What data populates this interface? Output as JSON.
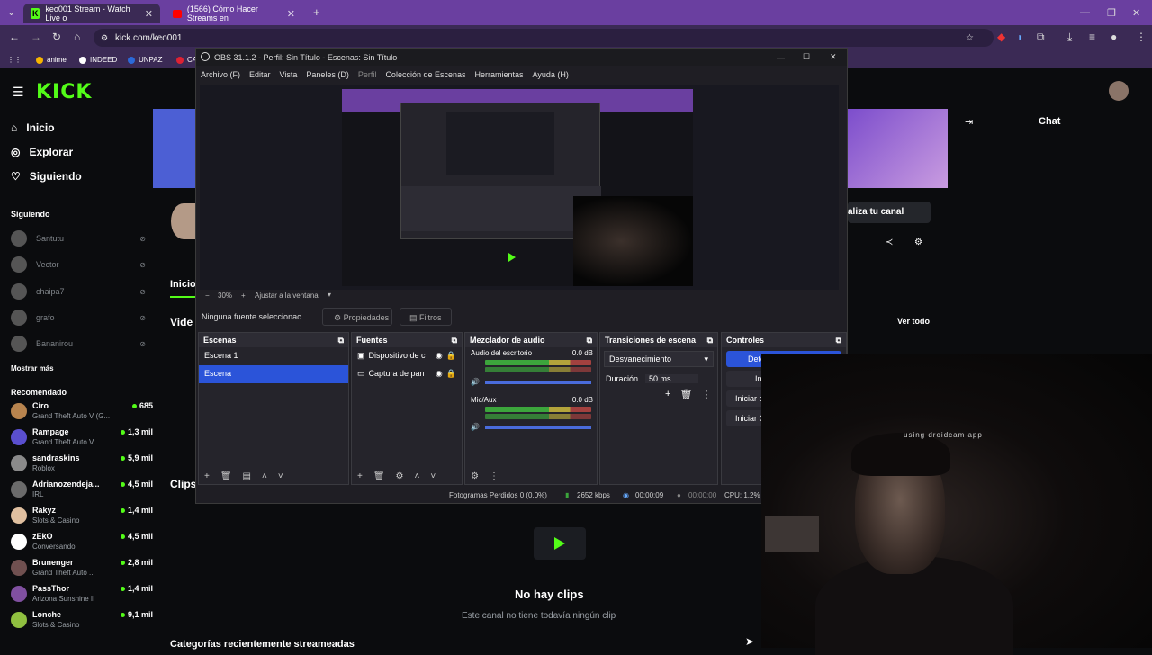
{
  "browser": {
    "tabs": [
      {
        "title": "keo001 Stream - Watch Live o",
        "active": true
      },
      {
        "title": "(1566) Cómo Hacer Streams en",
        "active": false
      }
    ],
    "url": "kick.com/keo001",
    "bookmarks": [
      "anime",
      "INDEED",
      "UNPAZ",
      "CA"
    ]
  },
  "kick": {
    "logo": "KICK",
    "nav": [
      "Inicio",
      "Explorar",
      "Siguiendo"
    ],
    "following_header": "Siguiendo",
    "following": [
      "Santutu",
      "Vector",
      "chaipa7",
      "grafo",
      "Bananirou"
    ],
    "show_more": "Mostrar más",
    "recommended_header": "Recomendado",
    "recommended": [
      {
        "name": "Ciro",
        "category": "Grand Theft Auto V (G...",
        "viewers": "685",
        "color": "#b8844e"
      },
      {
        "name": "Rampage",
        "category": "Grand Theft Auto V...",
        "viewers": "1,3 mil",
        "color": "#5a4fcf"
      },
      {
        "name": "sandraskins",
        "category": "Roblox",
        "viewers": "5,9 mil",
        "color": "#8a8a8a"
      },
      {
        "name": "Adrianozendeja...",
        "category": "IRL",
        "viewers": "4,5 mil",
        "color": "#6b6b6b"
      },
      {
        "name": "Rakyz",
        "category": "Slots & Casino",
        "viewers": "1,4 mil",
        "color": "#e0c0a0"
      },
      {
        "name": "zEkO",
        "category": "Conversando",
        "viewers": "4,5 mil",
        "color": "#ffffff"
      },
      {
        "name": "Brunenger",
        "category": "Grand Theft Auto ...",
        "viewers": "2,8 mil",
        "color": "#705050"
      },
      {
        "name": "PassThor",
        "category": "Arizona Sunshine II",
        "viewers": "1,4 mil",
        "color": "#8050a0"
      },
      {
        "name": "Lonche",
        "category": "Slots & Casino",
        "viewers": "9,1 mil",
        "color": "#90c040"
      }
    ],
    "chat_title": "Chat",
    "personalize": "aliza tu canal",
    "ver_todo": "Ver todo",
    "tab_inicio": "Inicio",
    "videos": "Vide",
    "clips": "Clips",
    "no_clips": "No hay clips",
    "no_clips_sub": "Este canal no tiene todavía ningún clip",
    "categories_recent": "Categorías recientemente streameadas"
  },
  "obs": {
    "title": "OBS 31.1.2 - Perfil: Sin Título - Escenas: Sin Título",
    "menu": [
      "Archivo (F)",
      "Editar",
      "Vista",
      "Paneles (D)",
      "Perfil",
      "Colección de Escenas",
      "Herramientas",
      "Ayuda (H)"
    ],
    "zoom": "30%",
    "fit": "Ajustar a la ventana",
    "no_source": "Ninguna fuente seleccionac",
    "properties": "Propiedades",
    "filters": "Filtros",
    "scenes_title": "Escenas",
    "scenes": [
      "Escena 1",
      "Escena"
    ],
    "sources_title": "Fuentes",
    "sources": [
      "Dispositivo de c",
      "Captura de pan"
    ],
    "mixer_title": "Mezclador de audio",
    "mixer": [
      {
        "name": "Audio del escritorio",
        "db": "0.0 dB"
      },
      {
        "name": "Mic/Aux",
        "db": "0.0 dB"
      }
    ],
    "transitions_title": "Transiciones de escena",
    "transition": "Desvanecimiento",
    "duration_label": "Duración",
    "duration": "50 ms",
    "controls_title": "Controles",
    "controls": [
      "Dete",
      "In",
      "Iniciar e",
      "Iniciar C"
    ],
    "status": {
      "dropped": "Fotogramas Perdidos 0 (0.0%)",
      "bitrate": "2652 kbps",
      "live": "00:00:09",
      "rec": "00:00:00",
      "cpu": "CPU: 1.2%"
    }
  },
  "webcam": {
    "label": "using droidcam app"
  }
}
